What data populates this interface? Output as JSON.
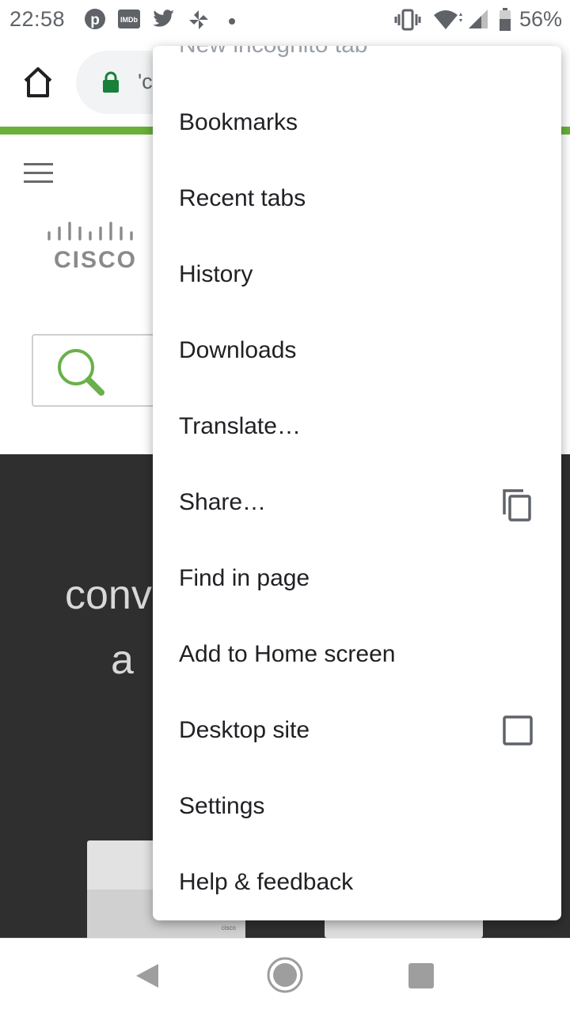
{
  "status_bar": {
    "time": "22:58",
    "notification_icons": [
      "pinterest-icon",
      "imdb-icon",
      "twitter-icon",
      "pinwheel-icon",
      "dot-icon"
    ],
    "imdb_text": "IMDb",
    "system_icons": [
      "vibrate-icon",
      "wifi-icon",
      "signal-icon",
      "battery-icon"
    ],
    "battery_percent": "56%"
  },
  "toolbar": {
    "home_icon": "home-icon",
    "lock_icon": "lock-icon",
    "url_text": "'c"
  },
  "page": {
    "menu_icon": "hamburger-icon",
    "logo_text": "CISCO",
    "search_icon": "search-icon",
    "hero_line1": "conv",
    "hero_line2": "a",
    "device_logo_text": "cisco",
    "colors": {
      "progress": "#69b13a",
      "hero_bg": "#2f2f2f",
      "search_green": "#6ab04c"
    }
  },
  "menu": {
    "partial_item": "New incognito tab",
    "items": [
      {
        "label": "Bookmarks"
      },
      {
        "label": "Recent tabs"
      },
      {
        "label": "History"
      },
      {
        "label": "Downloads"
      },
      {
        "label": "Translate…"
      },
      {
        "label": "Share…",
        "trailing_icon": "copy-icon"
      },
      {
        "label": "Find in page"
      },
      {
        "label": "Add to Home screen"
      },
      {
        "label": "Desktop site",
        "checkbox_checked": false
      },
      {
        "label": "Settings"
      },
      {
        "label": "Help & feedback"
      }
    ]
  },
  "navbar": {
    "icons": [
      "back-icon",
      "home-circle-icon",
      "recent-apps-icon"
    ]
  }
}
